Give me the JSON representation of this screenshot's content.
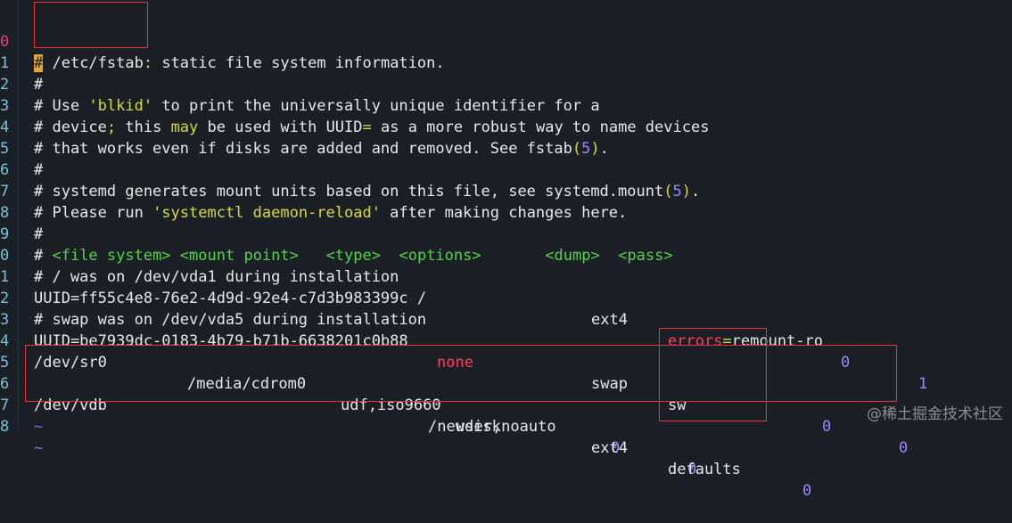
{
  "line_numbers": [
    "0",
    "1",
    "2",
    "3",
    "4",
    "5",
    "6",
    "7",
    "8",
    "9",
    "0",
    "1",
    "2",
    "3",
    "4",
    "5",
    "6",
    "7",
    "8"
  ],
  "lines": {
    "l0": {
      "hash": "#",
      "path": " /etc/fstab",
      "colon": ":",
      "rest": " static file system information."
    },
    "l1": "#",
    "l2": {
      "a": "# Use ",
      "b": "'blkid'",
      "c": " to print the universally unique identifier for a"
    },
    "l3": {
      "a": "# device",
      "b": ";",
      "c": " this ",
      "d": "may",
      "e": " be used with UUID",
      "f": "=",
      "g": " as a more robust way to name devices"
    },
    "l4": {
      "a": "# that works even if disks are added and removed. See fstab",
      "b": "(",
      "c": "5",
      "d": ")",
      "e": "."
    },
    "l5": "#",
    "l6": {
      "a": "# systemd generates mount units based on this file, see systemd.mount",
      "b": "(",
      "c": "5",
      "d": ")",
      "e": "."
    },
    "l7": {
      "a": "# Please run ",
      "b": "'systemctl daemon-reload'",
      "c": " after making changes here."
    },
    "l8": "#",
    "l9": {
      "a": "# ",
      "b": "<file system>",
      "c": " ",
      "d": "<mount point>",
      "e": "   ",
      "f": "<type>",
      "g": "  ",
      "h": "<options>",
      "i": "       ",
      "j": "<dump>",
      "k": "  ",
      "l": "<pass>"
    },
    "l10": "# / was on /dev/vda1 during installation",
    "l11": {
      "uuid": "UUID=ff55c4e8-76e2-4d9d-92e4-c7d3b983399c /",
      "type": "ext4",
      "opt1": "errors",
      "eq": "=",
      "opt2": "remount-ro",
      "dump": "0",
      "pass": "1"
    },
    "l12": "# swap was on /dev/vda5 during installation",
    "l13": {
      "uuid": "UUID=be7939dc-0183-4b79-b71b-6638201c0b88",
      "mnt": "none",
      "type": "swap",
      "opt": "sw",
      "dump": "0",
      "pass": "0"
    },
    "l14": {
      "dev": "/dev/sr0",
      "mnt": "/media/cdrom0",
      "type": "udf,iso9660",
      "opt": "user,noauto",
      "dump": "0",
      "pass": "0"
    },
    "l16": {
      "dev": "/dev/vdb",
      "mnt": "/newdisk",
      "type": "ext4",
      "opt": "defaults",
      "dump": "0"
    },
    "tilde": "~"
  },
  "watermark": "@稀土掘金技术社区",
  "colors": {
    "background": "#1b2027",
    "highlight_box": "#e83434",
    "cursor": "#e5a73d"
  }
}
